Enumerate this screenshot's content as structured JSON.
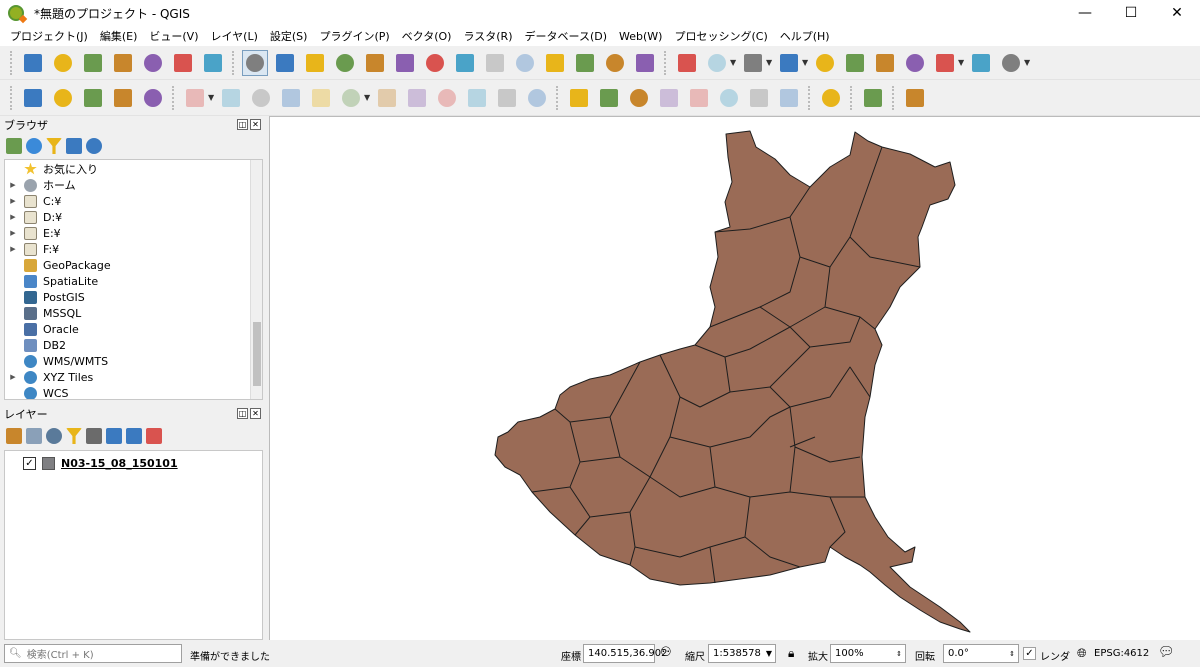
{
  "window": {
    "title": "*無題のプロジェクト - QGIS",
    "minimize_glyph": "—",
    "maximize_glyph": "☐",
    "close_glyph": "✕"
  },
  "menubar": [
    "プロジェクト(J)",
    "編集(E)",
    "ビュー(V)",
    "レイヤ(L)",
    "設定(S)",
    "プラグイン(P)",
    "ベクタ(O)",
    "ラスタ(R)",
    "データベース(D)",
    "Web(W)",
    "プロセッシング(C)",
    "ヘルプ(H)"
  ],
  "toolbar1": [
    "new-project-icon",
    "open-project-icon",
    "save-project-icon",
    "save-as-icon",
    "print-layout-icon",
    "layout-manager-icon",
    "style-manager-icon",
    "pan-icon",
    "pan-to-selection-icon",
    "zoom-in-icon",
    "zoom-out-icon",
    "zoom-native-icon",
    "zoom-full-icon",
    "zoom-selection-icon",
    "zoom-layer-icon",
    "zoom-last-icon",
    "zoom-next-icon",
    "new-bookmark-icon",
    "show-bookmarks-icon",
    "new-map-view-icon",
    "refresh-icon",
    "identify-icon",
    "action-icon",
    "select-features-icon",
    "deselect-icon",
    "open-attribute-table-icon",
    "field-calculator-icon",
    "statistics-icon",
    "sum-icon",
    "measure-icon",
    "map-tips-icon",
    "text-annotation-icon"
  ],
  "toolbar2": [
    "data-source-manager-icon",
    "new-geopackage-layer-icon",
    "new-shapefile-layer-icon",
    "new-spatialite-layer-icon",
    "new-virtual-layer-icon",
    "edits-icon",
    "toggle-editing-icon",
    "save-edits-icon",
    "add-feature-icon",
    "vertex-tool-icon",
    "modify-attributes-icon",
    "delete-selected-icon",
    "cut-features-icon",
    "copy-features-icon",
    "paste-features-icon",
    "undo-icon",
    "redo-icon",
    "label-toolbar-icon",
    "diagram-icon",
    "layer-labeling-icon",
    "pin-labels-icon",
    "show-hide-labels-icon",
    "move-label-icon",
    "rotate-label-icon",
    "change-label-icon",
    "plugins-icon",
    "python-console-icon",
    "help-icon"
  ],
  "browser": {
    "title": "ブラウザ",
    "items": [
      {
        "label": "お気に入り",
        "icon": "star-icon",
        "expandable": false
      },
      {
        "label": "ホーム",
        "icon": "home-icon",
        "expandable": true
      },
      {
        "label": "C:¥",
        "icon": "folder-icon",
        "expandable": true
      },
      {
        "label": "D:¥",
        "icon": "folder-icon",
        "expandable": true
      },
      {
        "label": "E:¥",
        "icon": "folder-icon",
        "expandable": true
      },
      {
        "label": "F:¥",
        "icon": "folder-icon",
        "expandable": true
      },
      {
        "label": "GeoPackage",
        "icon": "geopackage-icon",
        "expandable": false
      },
      {
        "label": "SpatiaLite",
        "icon": "spatialite-icon",
        "expandable": false
      },
      {
        "label": "PostGIS",
        "icon": "postgis-icon",
        "expandable": false
      },
      {
        "label": "MSSQL",
        "icon": "mssql-icon",
        "expandable": false
      },
      {
        "label": "Oracle",
        "icon": "oracle-icon",
        "expandable": false
      },
      {
        "label": "DB2",
        "icon": "db2-icon",
        "expandable": false
      },
      {
        "label": "WMS/WMTS",
        "icon": "wms-icon",
        "expandable": false
      },
      {
        "label": "XYZ Tiles",
        "icon": "xyz-tiles-icon",
        "expandable": true
      },
      {
        "label": "WCS",
        "icon": "wcs-icon",
        "expandable": false
      }
    ]
  },
  "layers": {
    "title": "レイヤー",
    "items": [
      {
        "name": "N03-15_08_150101",
        "checked": true
      }
    ]
  },
  "map": {
    "fill": "#9a6b56",
    "stroke": "#1e1e1e"
  },
  "status": {
    "search_placeholder": "検索(Ctrl + K)",
    "message": "準備ができました",
    "coord_label": "座標",
    "coord_value": "140.515,36.902",
    "scale_label": "縮尺",
    "scale_value": "1:538578",
    "mag_label": "拡大",
    "mag_value": "100%",
    "rot_label": "回転",
    "rot_value": "0.0°",
    "render_label": "レンダ",
    "crs": "EPSG:4612"
  }
}
